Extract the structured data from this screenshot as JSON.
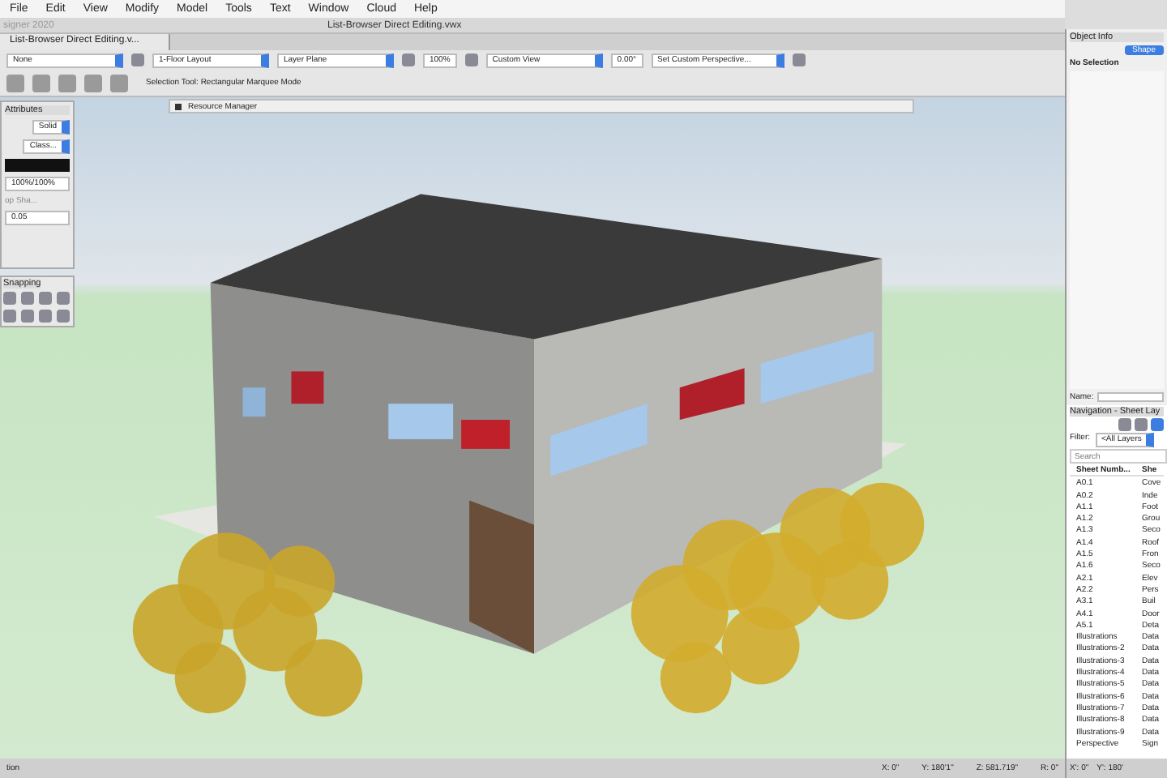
{
  "menu_bar": {
    "items": [
      "File",
      "Edit",
      "View",
      "Modify",
      "Model",
      "Tools",
      "Text",
      "Window",
      "Cloud",
      "Help"
    ]
  },
  "app_title": "signer 2020",
  "window": {
    "title": "List-Browser Direct Editing.vwx"
  },
  "tabs": [
    {
      "label": "List-Browser Direct Editing.v...",
      "selected": true
    }
  ],
  "view_bar": {
    "class": "None",
    "layer": "1-Floor Layout",
    "plane": "Layer Plane",
    "zoom": "100%",
    "view": "Custom View",
    "angle": "0.00°",
    "perspective": "Set Custom Perspective..."
  },
  "tool_bar": {
    "mode_hint": "Selection Tool: Rectangular Marquee Mode"
  },
  "resource_manager": {
    "title": "Resource Manager"
  },
  "attributes": {
    "title": "Attributes",
    "fill_style": "Solid",
    "class_style": "Class...",
    "opacity": "100%/100%",
    "drop_shadow": "op Sha...",
    "thickness": "0.05"
  },
  "snapping": {
    "title": "Snapping"
  },
  "object_info": {
    "title": "Object Info",
    "tabs": [
      {
        "label": "Shape",
        "selected": true
      }
    ],
    "selection": "No Selection",
    "name_label": "Name:"
  },
  "navigation": {
    "title": "Navigation - Sheet Lay",
    "filter_label": "Filter:",
    "filter_value": "<All Layers",
    "search_placeholder": "Search",
    "columns": [
      "Sheet Numb...",
      "She"
    ],
    "rows": [
      {
        "number": "A0.1",
        "title": "Cove"
      },
      {
        "number": "A0.2",
        "title": "Inde"
      },
      {
        "number": "A1.1",
        "title": "Foot"
      },
      {
        "number": "A1.2",
        "title": "Grou"
      },
      {
        "number": "A1.3",
        "title": "Seco"
      },
      {
        "number": "A1.4",
        "title": "Roof"
      },
      {
        "number": "A1.5",
        "title": "Fron"
      },
      {
        "number": "A1.6",
        "title": "Seco"
      },
      {
        "number": "A2.1",
        "title": "Elev"
      },
      {
        "number": "A2.2",
        "title": "Pers"
      },
      {
        "number": "A3.1",
        "title": "Buil"
      },
      {
        "number": "A4.1",
        "title": "Door"
      },
      {
        "number": "A5.1",
        "title": "Deta"
      },
      {
        "number": "Illustrations",
        "title": "Data"
      },
      {
        "number": "Illustrations-2",
        "title": "Data"
      },
      {
        "number": "Illustrations-3",
        "title": "Data"
      },
      {
        "number": "Illustrations-4",
        "title": "Data"
      },
      {
        "number": "Illustrations-5",
        "title": "Data"
      },
      {
        "number": "Illustrations-6",
        "title": "Data"
      },
      {
        "number": "Illustrations-7",
        "title": "Data"
      },
      {
        "number": "Illustrations-8",
        "title": "Data"
      },
      {
        "number": "Illustrations-9",
        "title": "Data"
      },
      {
        "number": "Perspective",
        "title": "Sign"
      }
    ]
  },
  "status_bar": {
    "left": "tion",
    "readouts": [
      "X: 0\"",
      "Y: 180'1\"",
      "Z: 581.719\"",
      "R: 0\""
    ],
    "panel_readouts": [
      "X': 0\"",
      "Y': 180'"
    ]
  }
}
